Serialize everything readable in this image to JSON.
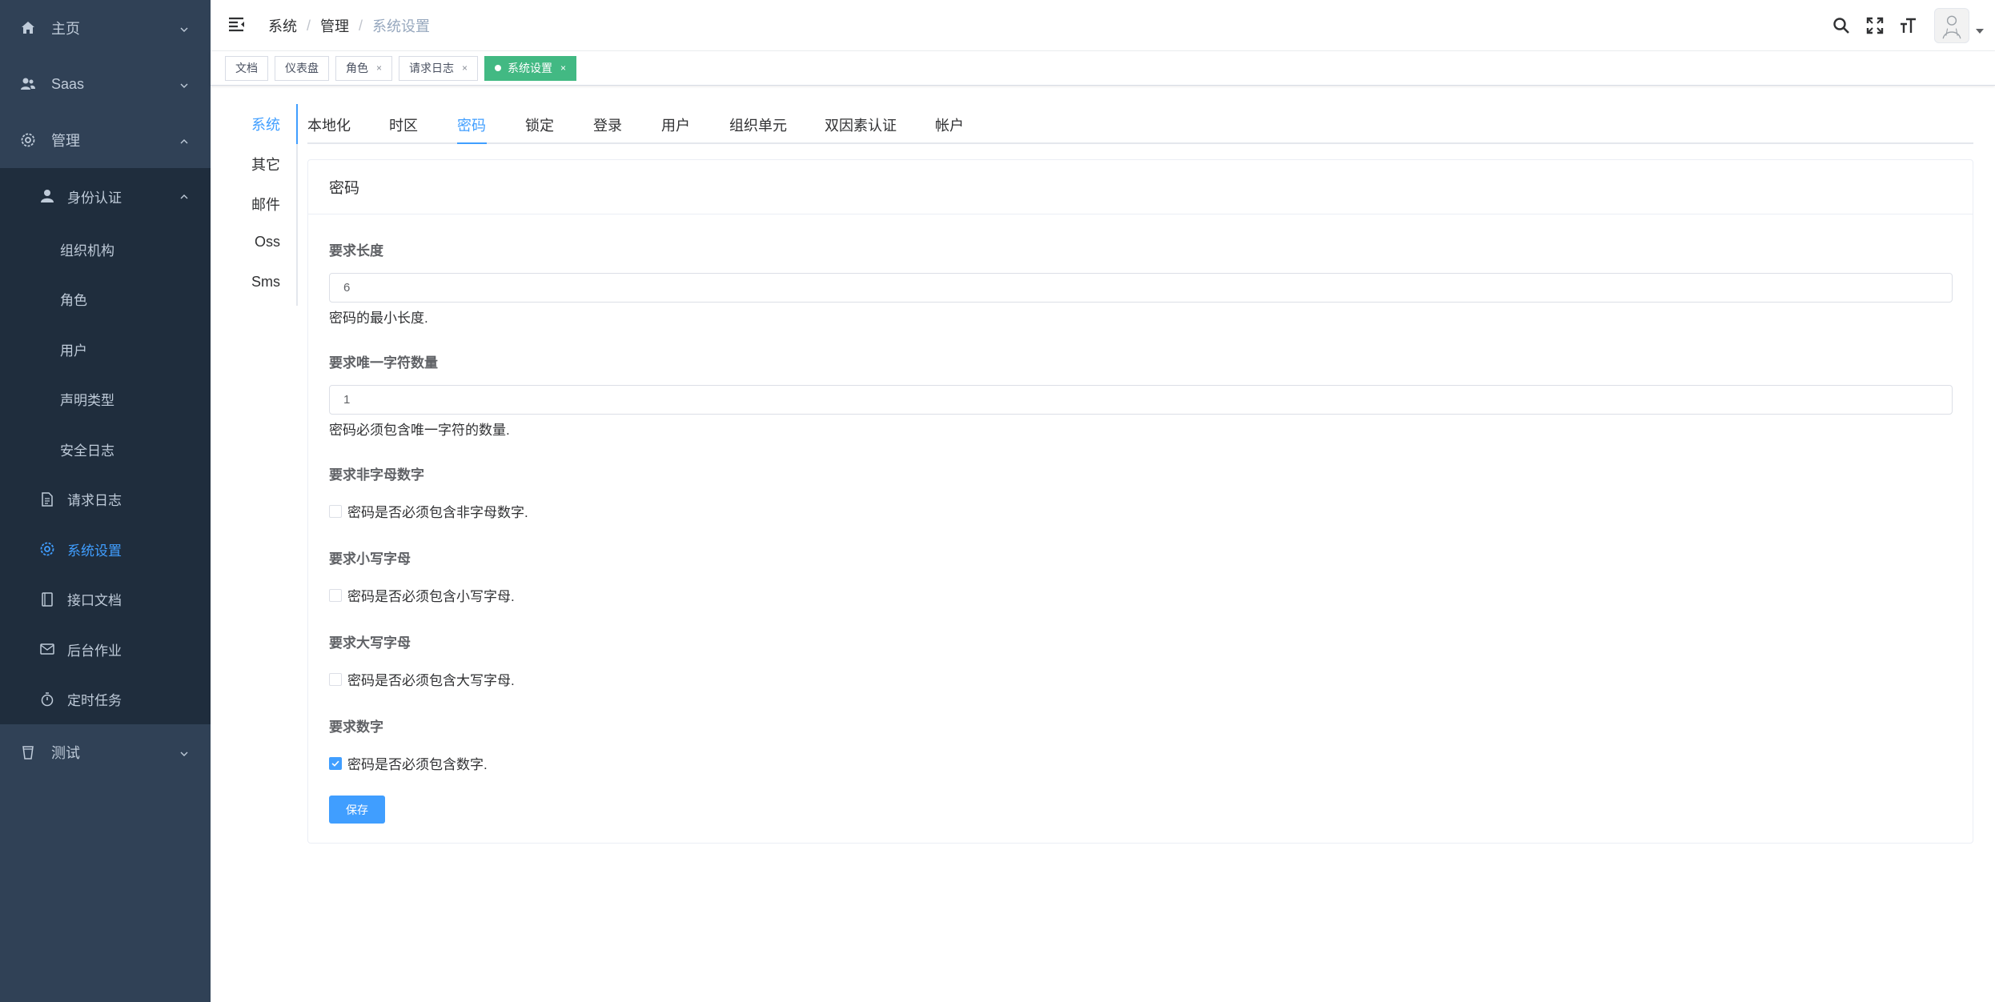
{
  "sidebar": {
    "items": [
      {
        "label": "主页",
        "icon": "home-icon"
      },
      {
        "label": "Saas",
        "icon": "users-icon"
      },
      {
        "label": "管理",
        "icon": "gear-icon"
      }
    ],
    "management_children": {
      "identity": {
        "label": "身份认证",
        "icon": "user-icon"
      },
      "identity_children": [
        "组织机构",
        "角色",
        "用户",
        "声明类型",
        "安全日志"
      ],
      "request_log": {
        "label": "请求日志",
        "icon": "document-icon"
      },
      "system_settings": {
        "label": "系统设置",
        "icon": "settings-icon"
      },
      "api_docs": {
        "label": "接口文档",
        "icon": "book-icon"
      },
      "background_jobs": {
        "label": "后台作业",
        "icon": "mail-icon"
      },
      "scheduled_tasks": {
        "label": "定时任务",
        "icon": "stopwatch-icon"
      }
    },
    "test": {
      "label": "测试",
      "icon": "cup-icon"
    }
  },
  "header": {
    "breadcrumb": [
      "系统",
      "管理",
      "系统设置"
    ],
    "separator": "/"
  },
  "tags": [
    {
      "label": "文档",
      "closable": false,
      "active": false
    },
    {
      "label": "仪表盘",
      "closable": false,
      "active": false
    },
    {
      "label": "角色",
      "closable": true,
      "active": false
    },
    {
      "label": "请求日志",
      "closable": true,
      "active": false
    },
    {
      "label": "系统设置",
      "closable": true,
      "active": true
    }
  ],
  "tag_close": "×",
  "left_tabs": [
    "系统",
    "其它",
    "邮件",
    "Oss",
    "Sms"
  ],
  "top_tabs": [
    "本地化",
    "时区",
    "密码",
    "锁定",
    "登录",
    "用户",
    "组织单元",
    "双因素认证",
    "帐户"
  ],
  "active_top_tab": "密码",
  "card": {
    "title": "密码",
    "length": {
      "label": "要求长度",
      "value": "6",
      "help": "密码的最小长度."
    },
    "unique": {
      "label": "要求唯一字符数量",
      "value": "1",
      "help": "密码必须包含唯一字符的数量."
    },
    "non_alnum": {
      "label": "要求非字母数字",
      "checkbox": "密码是否必须包含非字母数字.",
      "checked": false
    },
    "lowercase": {
      "label": "要求小写字母",
      "checkbox": "密码是否必须包含小写字母.",
      "checked": false
    },
    "uppercase": {
      "label": "要求大写字母",
      "checkbox": "密码是否必须包含大写字母.",
      "checked": false
    },
    "digit": {
      "label": "要求数字",
      "checkbox": "密码是否必须包含数字.",
      "checked": true
    },
    "save": "保存"
  },
  "colors": {
    "sidebar_bg": "#304156",
    "submenu_bg": "#1f2d3d",
    "accent": "#409eff",
    "tag_active": "#42b983"
  }
}
